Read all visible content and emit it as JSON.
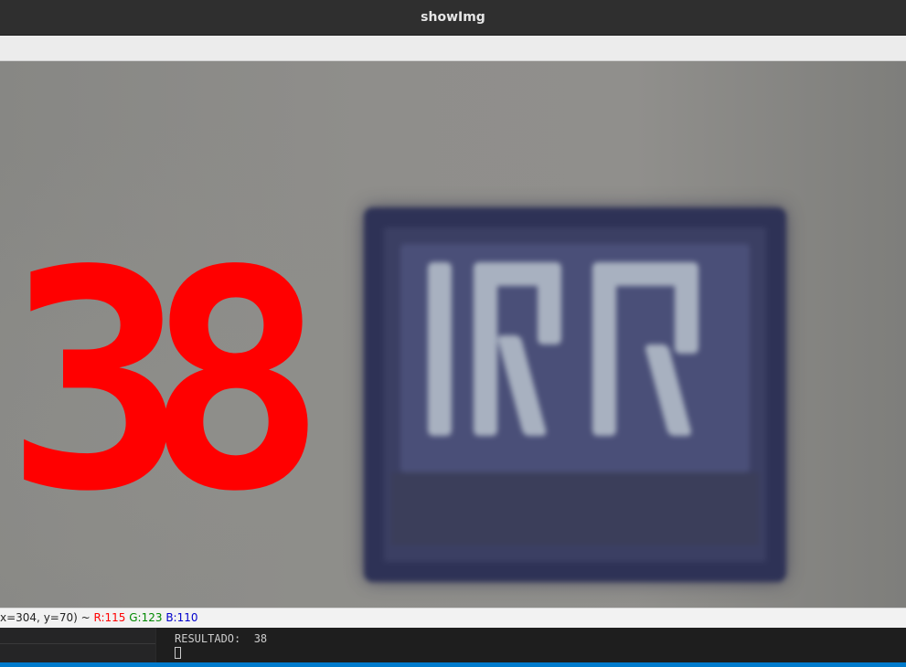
{
  "window": {
    "title": "showImg"
  },
  "image": {
    "overlay_number": "38",
    "overlay_color": "#ff0000"
  },
  "status": {
    "coords": "x=304, y=70) ~",
    "r": "R:115",
    "g": "G:123",
    "b": "B:110",
    "r_color": "#ff0000",
    "g_color": "#008800",
    "b_color": "#0000cc"
  },
  "terminal": {
    "result_line": "RESULTADO:  38"
  },
  "colors": {
    "accent": "#007acc"
  }
}
